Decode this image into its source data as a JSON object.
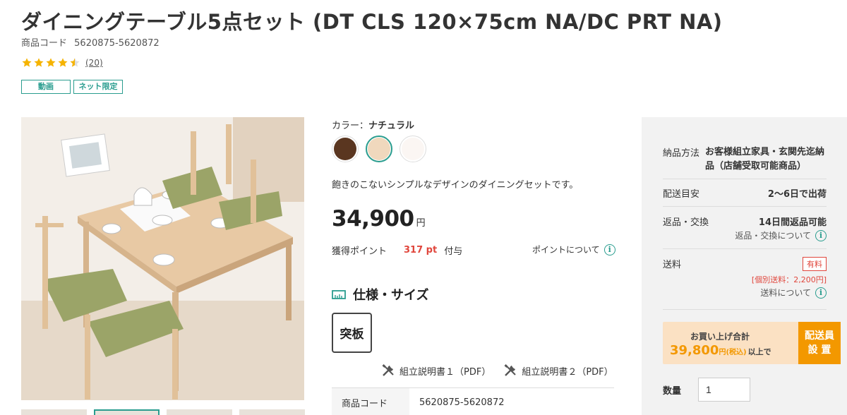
{
  "product": {
    "title": "ダイニングテーブル5点セット (DT CLS 120×75cm NA/DC PRT NA)",
    "code_label": "商品コード",
    "code_value": "5620875-5620872",
    "rating": 4.5,
    "review_count": "(20)",
    "tags": [
      "動画",
      "ネット限定"
    ]
  },
  "color": {
    "label": "カラー：",
    "selected": "ナチュラル",
    "swatches": [
      {
        "name": "dark-brown",
        "hex": "#5a3620"
      },
      {
        "name": "natural",
        "hex": "#f0d8bd"
      },
      {
        "name": "white",
        "hex": "#fbf6f3"
      }
    ]
  },
  "description": "飽きのこないシンプルなデザインのダイニングセットです。",
  "price": {
    "value": "34,900",
    "unit": "円"
  },
  "points": {
    "label": "獲得ポイント",
    "value": "317 pt",
    "suffix": "付与",
    "about": "ポイントについて"
  },
  "spec": {
    "heading": "仕様・サイズ",
    "material_badge": "突板",
    "manuals": [
      "組立説明書１（PDF）",
      "組立説明書２（PDF）"
    ],
    "table": [
      {
        "key": "商品コード",
        "value": "5620875-5620872"
      }
    ]
  },
  "panel": {
    "delivery_method_label": "納品方法",
    "delivery_method_value": "お客様組立家具・玄関先迄納品（店舗受取可能商品）",
    "shipping_estimate_label": "配送目安",
    "shipping_estimate_value": "2〜6日で出荷",
    "returns_label": "返品・交換",
    "returns_value": "14日間返品可能",
    "returns_about": "返品・交換について",
    "shipping_fee_label": "送料",
    "shipping_fee_badge": "有料",
    "shipping_fee_detail": "[個別送料：2,200円]",
    "shipping_fee_about": "送料について",
    "promo_title": "お買い上げ合計",
    "promo_amount": "39,800",
    "promo_amount_unit": "円(税込)",
    "promo_suffix": "以上で",
    "promo_button_line1": "配送員",
    "promo_button_line2": "設 置",
    "quantity_label": "数量",
    "quantity_value": "1"
  },
  "colors": {
    "accent": "#2a9d8f",
    "points_red": "#e0463c",
    "promo_orange": "#f39800",
    "star": "#f5b301"
  }
}
